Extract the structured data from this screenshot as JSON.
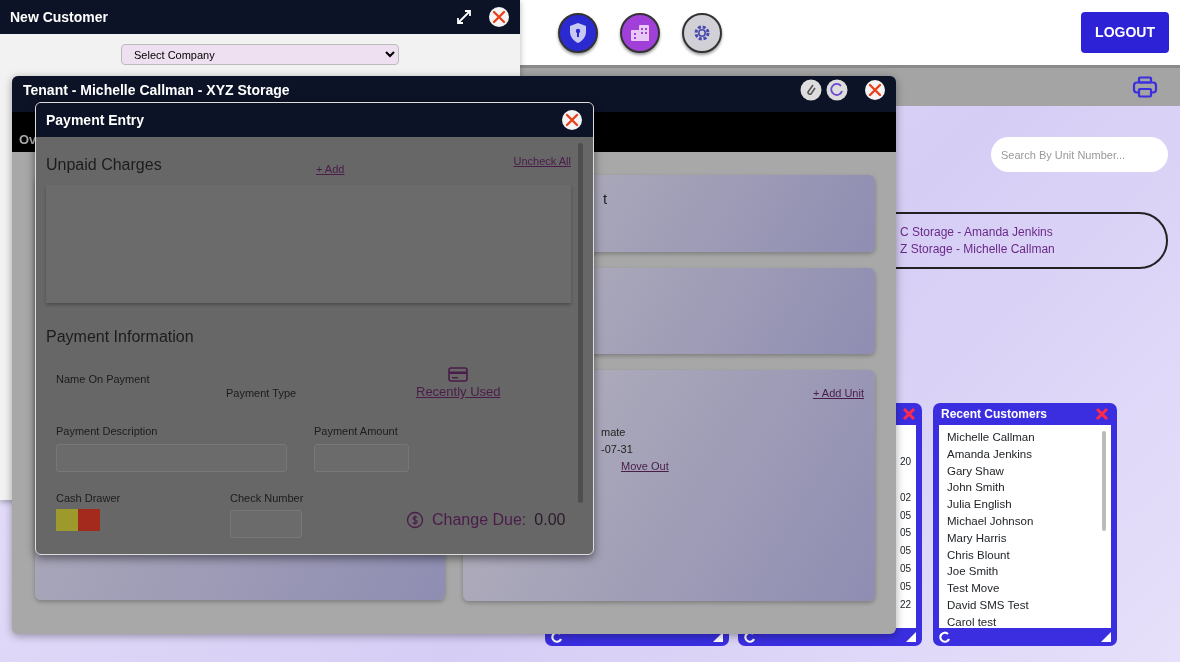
{
  "header": {
    "logout_button": "LOGOUT"
  },
  "search": {
    "placeholder": "Search By Unit Number..."
  },
  "recent_tenants": [
    "C Storage - Amanda Jenkins",
    "Z Storage - Michelle Callman"
  ],
  "units_widget": {
    "column_1": [
      "20",
      "02",
      "05",
      "05",
      "05",
      "05",
      "05",
      "22"
    ]
  },
  "recent_customers": {
    "title": "Recent Customers",
    "items": [
      "Michelle Callman",
      "Amanda Jenkins",
      "Gary Shaw",
      "John Smith",
      "Julia English",
      "Michael Johnson",
      "Mary Harris",
      "Chris Blount",
      "Joe Smith",
      "Test Move",
      "David SMS Test",
      "Carol test"
    ]
  },
  "new_customer": {
    "title": "New Customer",
    "company_select": {
      "value": "Select Company"
    }
  },
  "tenant_window": {
    "title": "Tenant - Michelle Callman - XYZ Storage",
    "tab": "Ov",
    "card_text": "t",
    "units_card": {
      "add_unit": "+ Add Unit",
      "lines": [
        "mate",
        "-07-31"
      ],
      "move_out": "Move Out"
    }
  },
  "payment_entry": {
    "title": "Payment Entry",
    "unpaid_charges": {
      "heading": "Unpaid Charges",
      "add": "+ Add",
      "uncheck_all": "Uncheck All"
    },
    "payment_information": {
      "heading": "Payment Information",
      "name_label": "Name On Payment",
      "type_label": "Payment Type",
      "recently_used": "Recently Used",
      "description_label": "Payment Description",
      "amount_label": "Payment Amount",
      "cash_drawer_label": "Cash Drawer",
      "cash_drawers": [
        {
          "color": "#9c9a2c"
        },
        {
          "color": "#a32a1c"
        }
      ],
      "check_label": "Check Number",
      "change_due_label": "Change Due:",
      "change_due": "0.00"
    }
  }
}
